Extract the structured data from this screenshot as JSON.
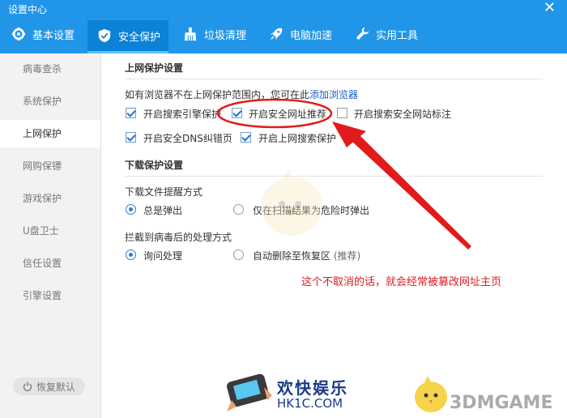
{
  "window": {
    "title": "设置中心",
    "close_glyph": "✕"
  },
  "tabs": [
    {
      "label": "基本设置",
      "icon": "gear-icon"
    },
    {
      "label": "安全保护",
      "icon": "shield-icon",
      "active": true
    },
    {
      "label": "垃圾清理",
      "icon": "broom-icon"
    },
    {
      "label": "电脑加速",
      "icon": "rocket-icon"
    },
    {
      "label": "实用工具",
      "icon": "wrench-icon"
    }
  ],
  "sidebar": {
    "items": [
      {
        "label": "病毒查杀"
      },
      {
        "label": "系统保护"
      },
      {
        "label": "上网保护",
        "active": true
      },
      {
        "label": "网购保镖"
      },
      {
        "label": "游戏保护"
      },
      {
        "label": "U盘卫士"
      },
      {
        "label": "信任设置"
      },
      {
        "label": "引擎设置"
      }
    ],
    "restore_label": "恢复默认"
  },
  "internet_protection": {
    "title": "上网保护设置",
    "hint_prefix": "如有浏览器不在上网保护范围内，您可在此",
    "add_browser_link": "添加浏览器",
    "options": [
      {
        "label": "开启搜索引擎保护",
        "checked": true
      },
      {
        "label": "开启安全网址推荐",
        "checked": true
      },
      {
        "label": "开启搜索安全网站标注",
        "checked": false
      },
      {
        "label": "开启安全DNS纠错页",
        "checked": true
      },
      {
        "label": "开启上网搜索保护",
        "checked": true
      }
    ]
  },
  "download_protection": {
    "title": "下载保护设置",
    "reminder_label": "下载文件提醒方式",
    "reminder_options": [
      {
        "label": "总是弹出",
        "selected": true
      },
      {
        "label": "仅在扫描结果为危险时弹出",
        "selected": false
      }
    ],
    "handling_label": "拦截到病毒后的处理方式",
    "handling_options": [
      {
        "label": "询问处理",
        "selected": true
      },
      {
        "label": "自动删除至恢复区",
        "selected": false,
        "note": "(推荐)"
      }
    ]
  },
  "annotation": {
    "text": "这个不取消的话，就会经常被篡改网址主页",
    "color": "#e11b1b"
  },
  "watermarks": {
    "site_name": "欢快娱乐",
    "site_url": "HK1C.COM",
    "brand": "3DMGAME"
  },
  "colors": {
    "header": "#2196e8",
    "active_tab": "#0c82d6",
    "link": "#1a5fc7"
  }
}
